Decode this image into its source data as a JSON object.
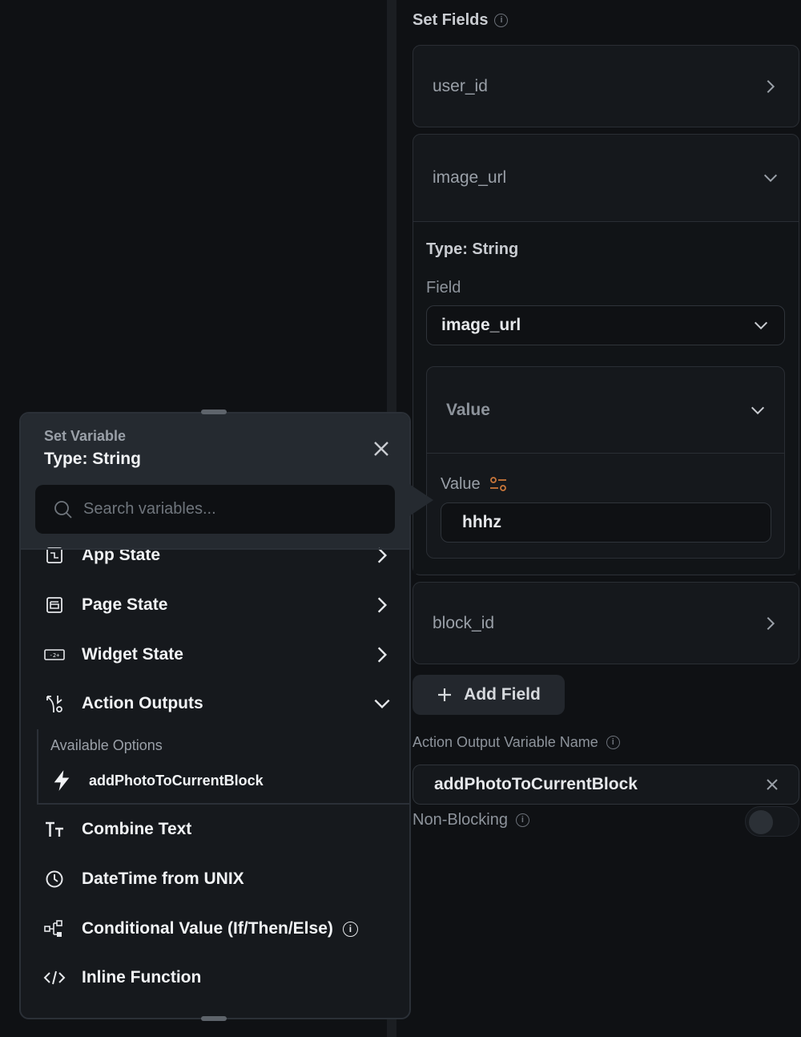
{
  "right_panel": {
    "set_fields_title": "Set Fields",
    "fields": [
      {
        "name": "user_id",
        "state": "collapsed"
      },
      {
        "name": "image_url",
        "state": "expanded"
      },
      {
        "name": "block_id",
        "state": "collapsed"
      }
    ],
    "expanded": {
      "type_label": "Type: String",
      "field_label": "Field",
      "field_value": "image_url",
      "value_header": "Value",
      "value_label": "Value",
      "value_input": "hhhz"
    },
    "add_field_label": "Add Field",
    "action_output_label": "Action Output Variable Name",
    "action_output_value": "addPhotoToCurrentBlock",
    "non_blocking_label": "Non-Blocking",
    "non_blocking_enabled": false
  },
  "popup": {
    "title": "Set Variable",
    "type": "Type: String",
    "search_placeholder": "Search variables...",
    "items": [
      {
        "label": "App State",
        "icon": "app-state-icon",
        "trail": "chevron-right"
      },
      {
        "label": "Page State",
        "icon": "page-state-icon",
        "trail": "chevron-right"
      },
      {
        "label": "Widget State",
        "icon": "widget-state-icon",
        "trail": "chevron-right"
      },
      {
        "label": "Action Outputs",
        "icon": "action-outputs-icon",
        "trail": "chevron-down"
      },
      {
        "label": "Combine Text",
        "icon": "text-icon",
        "trail": ""
      },
      {
        "label": "DateTime from UNIX",
        "icon": "clock-icon",
        "trail": ""
      },
      {
        "label": "Conditional Value (If/Then/Else)",
        "icon": "conditional-icon",
        "trail": "info"
      },
      {
        "label": "Inline Function",
        "icon": "code-icon",
        "trail": ""
      }
    ],
    "available_options_label": "Available Options",
    "available_options": [
      {
        "label": "addPhotoToCurrentBlock",
        "icon": "lightning-icon"
      }
    ]
  },
  "colors": {
    "background": "#0f1114",
    "popup_header": "#252a30",
    "accent_orange": "#c8763a"
  }
}
